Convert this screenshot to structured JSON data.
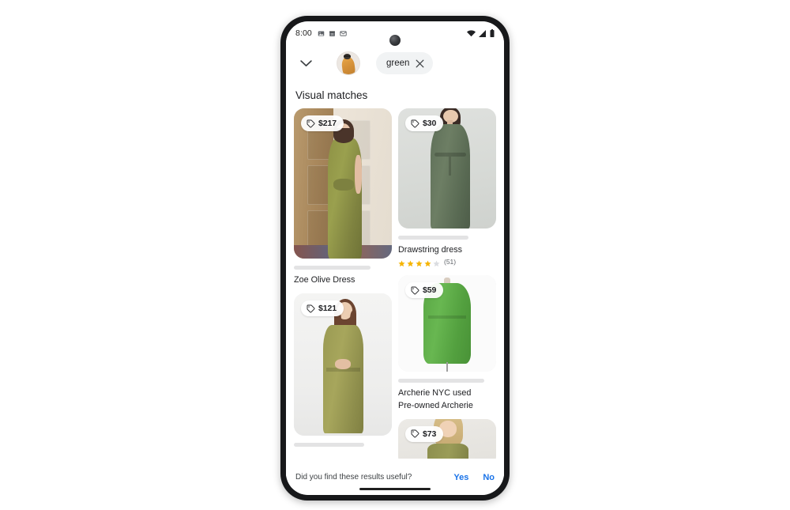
{
  "status_bar": {
    "time": "8:00",
    "left_icons": [
      "image-icon",
      "calendar-icon",
      "mail-icon"
    ],
    "right_icons": [
      "wifi-icon",
      "cellular-signal-icon",
      "battery-icon"
    ]
  },
  "top_bar": {
    "collapse_icon": "chevron-down-icon",
    "avatar_label": "source-image-thumbnail",
    "chip": {
      "label": "green",
      "close_icon": "close-icon"
    }
  },
  "section": {
    "title": "Visual matches"
  },
  "results": {
    "left_column": [
      {
        "price": "$217",
        "price_icon": "price-tag-icon",
        "title": "Zoe Olive Dress",
        "scene": "olive-wrap-dress-doorway",
        "has_placeholder_bar": true,
        "rating": null,
        "reviews": null,
        "subtitle": null
      },
      {
        "price": "$121",
        "price_icon": "price-tag-icon",
        "title": "",
        "scene": "olive-sleeveless-dress-studio",
        "has_placeholder_bar": true,
        "rating": null,
        "reviews": null,
        "subtitle": null
      }
    ],
    "right_column": [
      {
        "price": "$30",
        "price_icon": "price-tag-icon",
        "title": "Drawstring dress",
        "scene": "sage-drawstring-dress",
        "has_placeholder_bar": true,
        "rating": 4,
        "rating_max": 5,
        "reviews": "(51)",
        "subtitle": null
      },
      {
        "price": "$59",
        "price_icon": "price-tag-icon",
        "title": "Archerie NYC used",
        "subtitle": "Pre-owned Archerie",
        "scene": "green-dress-mannequin",
        "has_placeholder_bar": true,
        "rating": null,
        "reviews": null
      },
      {
        "price": "$73",
        "price_icon": "price-tag-icon",
        "title": "",
        "scene": "blonde-model-olive-dress",
        "has_placeholder_bar": false,
        "rating": null,
        "reviews": null,
        "subtitle": null
      }
    ]
  },
  "feedback": {
    "question": "Did you find these results useful?",
    "yes_label": "Yes",
    "no_label": "No"
  },
  "colors": {
    "link_blue": "#1a73e8",
    "star_gold": "#f5b400",
    "star_empty": "#dadce0",
    "chip_bg": "#f1f3f4",
    "text_primary": "#202124",
    "text_secondary": "#5f6368"
  }
}
